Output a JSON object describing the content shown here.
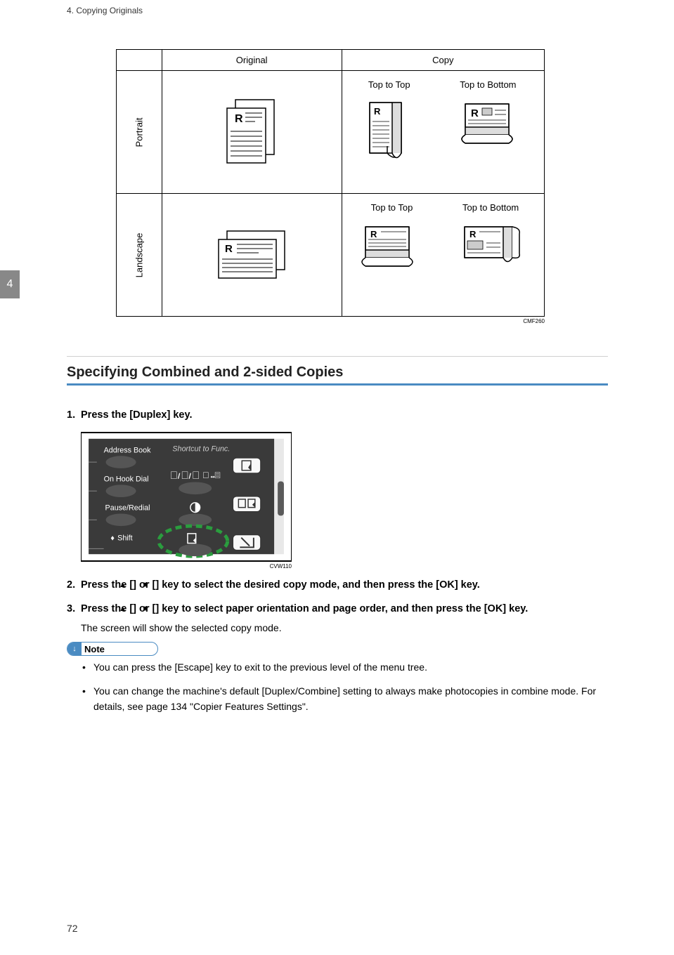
{
  "header": "4. Copying Originals",
  "side_tab": "4",
  "page_number": "72",
  "table": {
    "col_original": "Original",
    "col_copy": "Copy",
    "row_portrait": "Portrait",
    "row_landscape": "Landscape",
    "top_to_top": "Top to Top",
    "top_to_bottom": "Top to Bottom",
    "figure_code": "CMF260"
  },
  "section_heading": "Specifying Combined and 2-sided Copies",
  "steps": {
    "s1_num": "1.",
    "s1": "Press the [Duplex] key.",
    "panel_code": "CVW110",
    "s2_num": "2.",
    "s2_a": "Press the [",
    "s2_up": "▲",
    "s2_b": "] or [",
    "s2_down": "▼",
    "s2_c": "] key to select the desired copy mode, and then press the [OK] key.",
    "s3_num": "3.",
    "s3_a": "Press the [",
    "s3_b": "] or [",
    "s3_c": "] key to select paper orientation and page order, and then press the [OK] key.",
    "s3_body": "The screen will show the selected copy mode."
  },
  "note": {
    "label": "Note",
    "b1": "You can press the [Escape] key to exit to the previous level of the menu tree.",
    "b2": "You can change the machine's default [Duplex/Combine] setting to always make photocopies in combine mode. For details, see page 134 \"Copier Features Settings\"."
  },
  "panel": {
    "address_book": "Address Book",
    "shortcut": "Shortcut to Func.",
    "on_hook": "On Hook Dial",
    "pause": "Pause/Redial",
    "shift": "Shift"
  }
}
